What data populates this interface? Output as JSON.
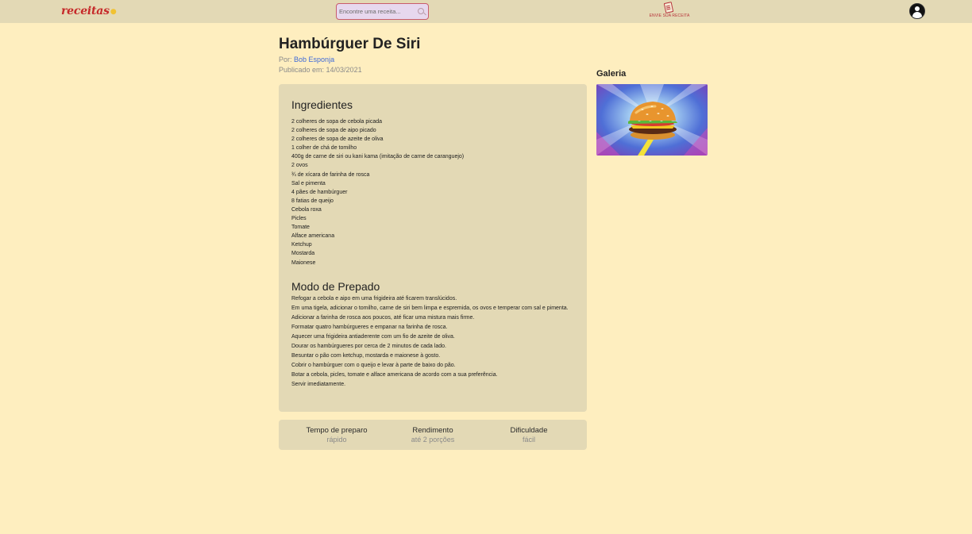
{
  "header": {
    "logo": "receitas",
    "search_placeholder": "Encontre uma receita...",
    "send_recipe_label": "ENVIE SUA RECEITA"
  },
  "recipe": {
    "title": "Hambúrguer De Siri",
    "author_prefix": "Por:",
    "author": "Bob Esponja",
    "published": "Publicado em: 14/03/2021",
    "ingredients_title": "Ingredientes",
    "ingredients": [
      "2 colheres de sopa de cebola picada",
      "2 colheres de sopa de aipo picado",
      "2 colheres de sopa de azeite de oliva",
      "1 colher de chá de tomilho",
      "400g de carne de siri ou kani kama (imitação de carne de caranguejo)",
      "2 ovos",
      "¾ de xícara de farinha de rosca",
      "Sal e pimenta",
      "4 pães de hambúrguer",
      "8 fatias de queijo",
      "Cebola roxa",
      "Picles",
      "Tomate",
      "Alface americana",
      "Ketchup",
      "Mostarda",
      "Maionese"
    ],
    "preparation_title": "Modo de Prepado",
    "preparation": [
      "Refogar a cebola e aipo em uma frigideira até ficarem translúcidos.",
      "Em uma tigela, adicionar o tomilho, carne de siri bem limpa e espremida, os ovos e temperar com sal e pimenta.",
      "Adicionar a farinha de rosca aos poucos, até ficar uma mistura mais firme.",
      "Formatar quatro hambúrgueres e empanar na farinha de rosca.",
      "Aquecer uma frigideira antiaderente com um fio de azeite de oliva.",
      "Dourar os hambúrgueres por cerca de 2 minutos de cada lado.",
      "Besuntar o pão com ketchup, mostarda e maionese à gosto.",
      "Cobrir o hambúrguer com o queijo e levar à parte de baixo do pão.",
      "Botar a cebola, picles, tomate e alface americana de acordo com a sua preferência.",
      "Servir imediatamente."
    ],
    "info": [
      {
        "label": "Tempo de preparo",
        "value": "rápido"
      },
      {
        "label": "Rendimento",
        "value": "até 2 porções"
      },
      {
        "label": "Dificuldade",
        "value": "fácil"
      }
    ]
  },
  "gallery": {
    "title": "Galeria",
    "image_icon": "krabby-patty-photo"
  },
  "colors": {
    "background": "#feeebf",
    "panel": "#e3d9b5",
    "brand_red": "#c62a2a",
    "link_blue": "#3f6ad8"
  }
}
